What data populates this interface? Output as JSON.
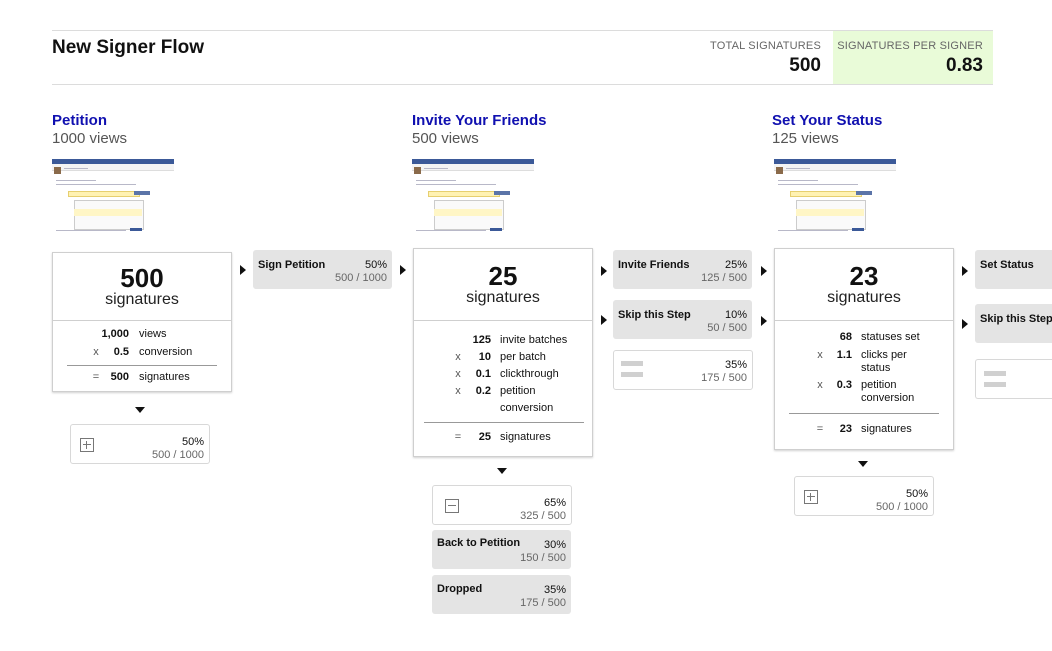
{
  "header": {
    "title": "New Signer Flow",
    "metrics": [
      {
        "label": "TOTAL SIGNATURES",
        "value": "500"
      },
      {
        "label": "SIGNATURES PER SIGNER",
        "value": "0.83"
      }
    ],
    "accent_color": "#e9fbd8"
  },
  "steps": [
    {
      "title": "Petition",
      "views": "1000 views",
      "card": {
        "number": "500",
        "unit": "signatures",
        "rows": [
          {
            "op": "",
            "value": "1,000",
            "label": "views"
          },
          {
            "op": "x",
            "value": "0.5",
            "label": "conversion"
          }
        ],
        "total": {
          "op": "=",
          "value": "500",
          "label": "signatures"
        }
      },
      "outcomes": [
        {
          "type": "collapsed",
          "pct": "50%",
          "frac": "500 / 1000"
        }
      ],
      "transitions": [
        {
          "label": "Sign Petition",
          "pct": "50%",
          "frac": "500 / 1000"
        }
      ]
    },
    {
      "title": "Invite Your Friends",
      "views": "500 views",
      "card": {
        "number": "25",
        "unit": "signatures",
        "rows": [
          {
            "op": "",
            "value": "125",
            "label": "invite batches"
          },
          {
            "op": "x",
            "value": "10",
            "label": "per batch"
          },
          {
            "op": "x",
            "value": "0.1",
            "label": "clickthrough"
          },
          {
            "op": "x",
            "value": "0.2",
            "label": "petition",
            "label2": "conversion"
          }
        ],
        "total": {
          "op": "=",
          "value": "25",
          "label": "signatures"
        }
      },
      "outcomes": [
        {
          "type": "expanded",
          "pct": "65%",
          "frac": "325 / 500"
        },
        {
          "label": "Back to Petition",
          "pct": "30%",
          "frac": "150 / 500"
        },
        {
          "label": "Dropped",
          "pct": "35%",
          "frac": "175 / 500"
        }
      ],
      "transitions": [
        {
          "label": "Invite Friends",
          "pct": "25%",
          "frac": "125 / 500"
        },
        {
          "label": "Skip this Step",
          "pct": "10%",
          "frac": "50 / 500"
        },
        {
          "type": "other",
          "pct": "35%",
          "frac": "175 / 500"
        }
      ]
    },
    {
      "title": "Set Your Status",
      "views": "125 views",
      "card": {
        "number": "23",
        "unit": "signatures",
        "rows": [
          {
            "op": "",
            "value": "68",
            "label": "statuses set"
          },
          {
            "op": "x",
            "value": "1.1",
            "label": "clicks per",
            "label2": "status"
          },
          {
            "op": "x",
            "value": "0.3",
            "label": "petition",
            "label2": "conversion"
          }
        ],
        "total": {
          "op": "=",
          "value": "23",
          "label": "signatures"
        }
      },
      "outcomes": [
        {
          "type": "collapsed",
          "pct": "50%",
          "frac": "500 / 1000"
        }
      ],
      "transitions": [
        {
          "label": "Set Status"
        },
        {
          "label": "Skip this Step"
        }
      ]
    }
  ]
}
